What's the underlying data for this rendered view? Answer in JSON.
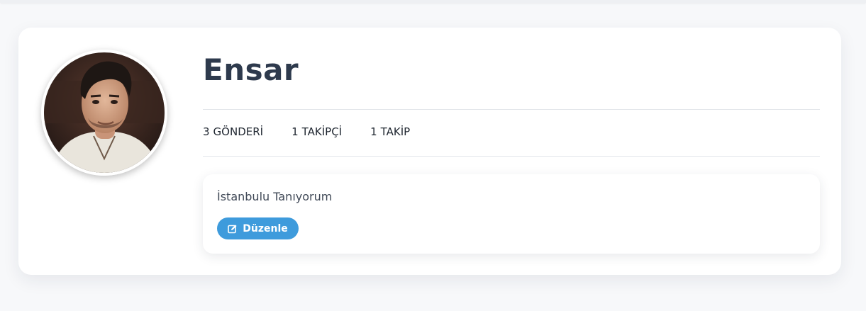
{
  "profile": {
    "username": "Ensar",
    "avatar_icon": "user-photo",
    "stats": [
      {
        "value": "3",
        "label": "GÖNDERİ"
      },
      {
        "value": "1",
        "label": "TAKİPÇİ"
      },
      {
        "value": "1",
        "label": "TAKİP"
      }
    ],
    "bio": "İstanbulu Tanıyorum",
    "edit_label": "Düzenle",
    "edit_icon": "edit-icon"
  },
  "colors": {
    "accent": "#3e9bdc",
    "title": "#2e3a4d",
    "background": "#f7f8fa",
    "card": "#ffffff"
  }
}
